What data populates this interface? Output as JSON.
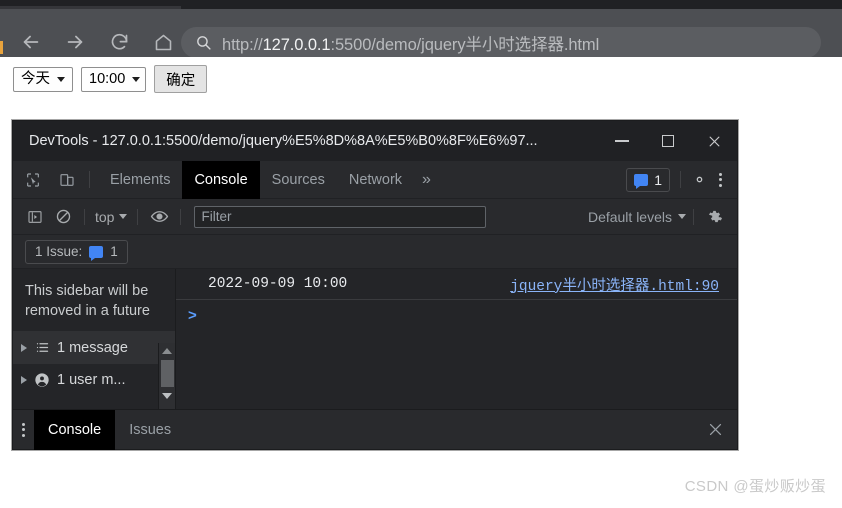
{
  "browser": {
    "nav": {
      "back_label": "Back",
      "forward_label": "Forward",
      "reload_label": "Reload",
      "home_label": "Home"
    },
    "omnibox": {
      "search_icon": "search-icon",
      "url_scheme": "http://",
      "url_host": "127.0.0.1",
      "url_rest": ":5500/demo/jquery半小时选择器.html",
      "full_url": "http://127.0.0.1:5500/demo/jquery半小时选择器.html"
    }
  },
  "page": {
    "day_select": {
      "value": "今天"
    },
    "time_select": {
      "value": "10:00"
    },
    "confirm_button": {
      "label": "确定"
    }
  },
  "devtools": {
    "window_title": "DevTools - 127.0.0.1:5500/demo/jquery%E5%8D%8A%E5%B0%8F%E6%97...",
    "window_controls": {
      "minimize": "−",
      "maximize": "□",
      "close": "✕"
    },
    "tabs": [
      {
        "label": "Elements",
        "active": false
      },
      {
        "label": "Console",
        "active": true
      },
      {
        "label": "Sources",
        "active": false
      },
      {
        "label": "Network",
        "active": false
      }
    ],
    "tabs_overflow": "»",
    "issue_badge": {
      "count": "1",
      "icon": "message-icon"
    },
    "console_toolbar": {
      "sidebar_toggle_icon": "sidebar-toggle-icon",
      "clear_icon": "clear-console-icon",
      "context_label": "top",
      "eye_icon": "live-expression-icon",
      "filter_placeholder": "Filter",
      "levels_label": "Default levels",
      "settings_icon": "gear-icon"
    },
    "issue_bar": {
      "text": "1 Issue:",
      "count": "1"
    },
    "sidebar": {
      "note": "This sidebar will be removed in a future",
      "rows": [
        {
          "label": "1 message",
          "icon": "list-icon"
        },
        {
          "label": "1 user m...",
          "icon": "user-icon"
        }
      ]
    },
    "console": {
      "messages": [
        {
          "text": "2022-09-09 10:00",
          "source": "jquery半小时选择器.html:90"
        }
      ],
      "prompt": ">"
    },
    "drawer": {
      "tabs": [
        {
          "label": "Console",
          "active": true
        },
        {
          "label": "Issues",
          "active": false
        }
      ],
      "close_label": "✕"
    }
  },
  "watermark": {
    "text": "CSDN @蛋炒贩炒蛋"
  },
  "colors": {
    "browser_toolbar": "#4d4f53",
    "devtools_bg": "#292a2d",
    "devtools_panel": "#242528",
    "accent_blue": "#4285f4",
    "link_blue": "#8ab4f8",
    "active_tab_bg": "#000000"
  }
}
